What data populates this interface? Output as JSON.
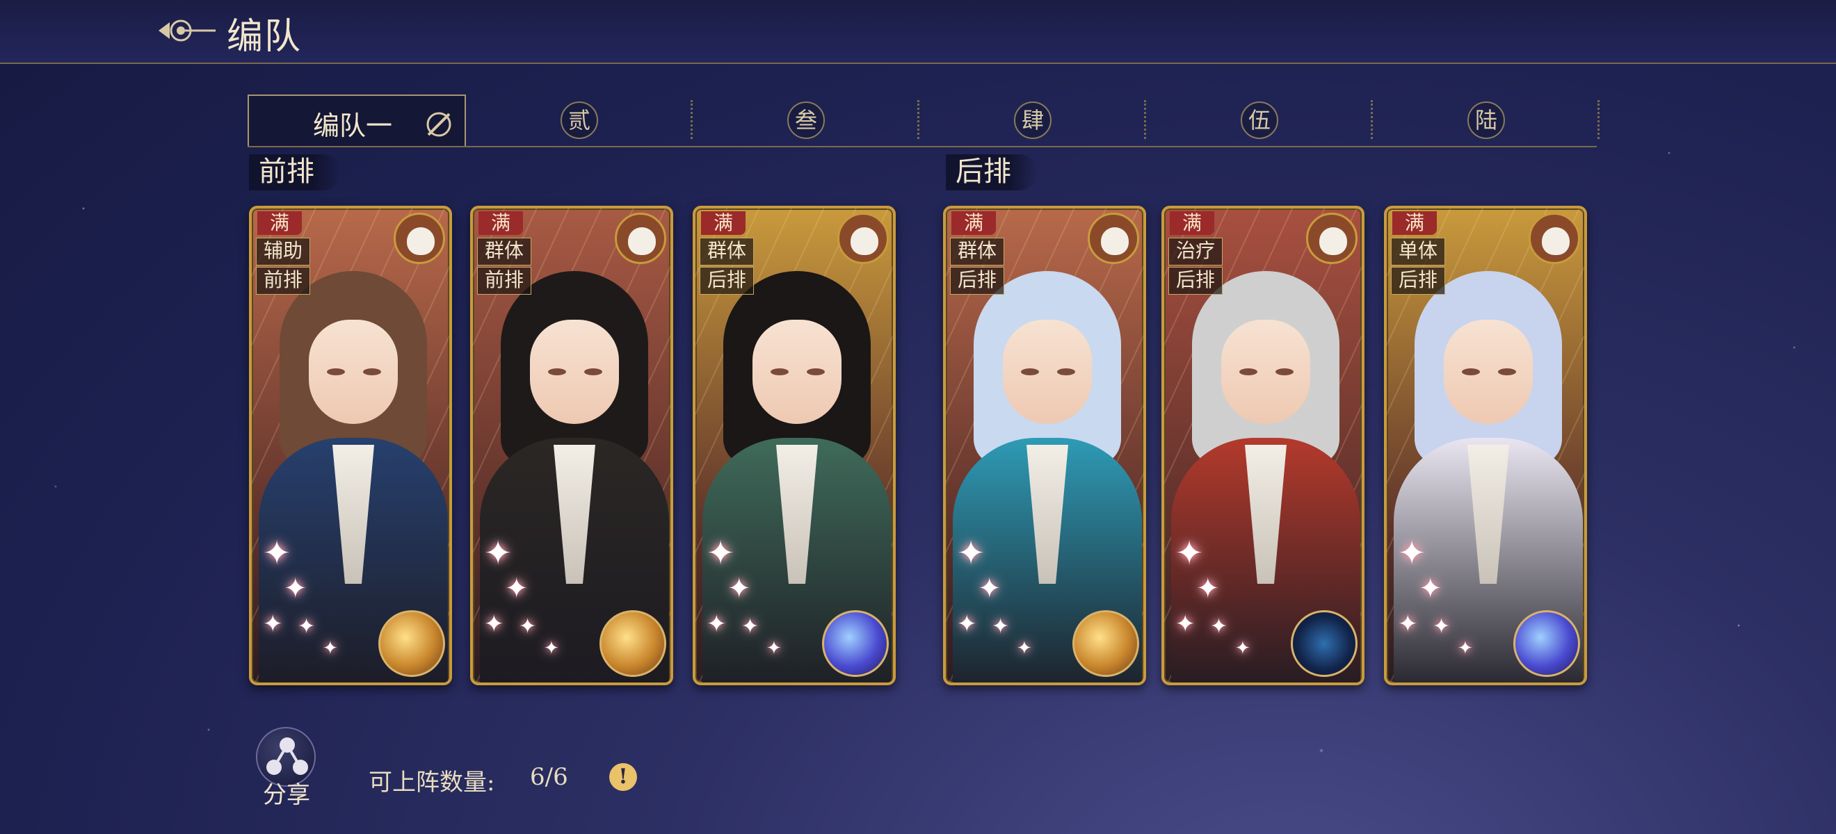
{
  "header": {
    "title": "编队"
  },
  "tabs": [
    {
      "label": "编队一",
      "active": true
    },
    {
      "label": "贰"
    },
    {
      "label": "叁"
    },
    {
      "label": "肆"
    },
    {
      "label": "伍"
    },
    {
      "label": "陆"
    }
  ],
  "rows": {
    "front_label": "前排",
    "back_label": "后排"
  },
  "cards": [
    {
      "badge": "满",
      "tag1": "辅助",
      "tag2": "前排",
      "pet_icon": "white-goat-icon",
      "orb_icon": "golden-planet-orb-icon",
      "stars": 5,
      "theme_color": "#b8694a",
      "hair_color": "#6f4a36",
      "outfit_color": "#27406e"
    },
    {
      "badge": "满",
      "tag1": "群体",
      "tag2": "前排",
      "pet_icon": "white-wolf-icon",
      "orb_icon": "golden-sun-orb-icon",
      "stars": 5,
      "theme_color": "#a85a44",
      "hair_color": "#1f1a1a",
      "outfit_color": "#2b2724"
    },
    {
      "badge": "满",
      "tag1": "群体",
      "tag2": "后排",
      "pet_icon": "white-sheep-icon",
      "orb_icon": "blue-planet-orb-icon",
      "stars": 5,
      "theme_color": "#c99a3c",
      "hair_color": "#1a1716",
      "outfit_color": "#3f6b5a"
    },
    {
      "badge": "满",
      "tag1": "群体",
      "tag2": "后排",
      "pet_icon": "blue-fish-icon",
      "orb_icon": "golden-planet-orb-icon",
      "stars": 5,
      "theme_color": "#b8694a",
      "hair_color": "#c9d9ef",
      "outfit_color": "#2e9bb6"
    },
    {
      "badge": "满",
      "tag1": "治疗",
      "tag2": "后排",
      "pet_icon": "white-goat-icon",
      "orb_icon": "compass-orb-icon",
      "stars": 5,
      "theme_color": "#a85040",
      "hair_color": "#cfcfcf",
      "outfit_color": "#b43a2c"
    },
    {
      "badge": "满",
      "tag1": "单体",
      "tag2": "后排",
      "pet_icon": "panda-icon",
      "orb_icon": "blue-planet-orb-icon",
      "stars": 5,
      "theme_color": "#c99a3c",
      "hair_color": "#c8d4ee",
      "outfit_color": "#e9e6f1"
    }
  ],
  "footer": {
    "share_label": "分享",
    "count_label": "可上阵数量:",
    "count_value": "6/6"
  }
}
